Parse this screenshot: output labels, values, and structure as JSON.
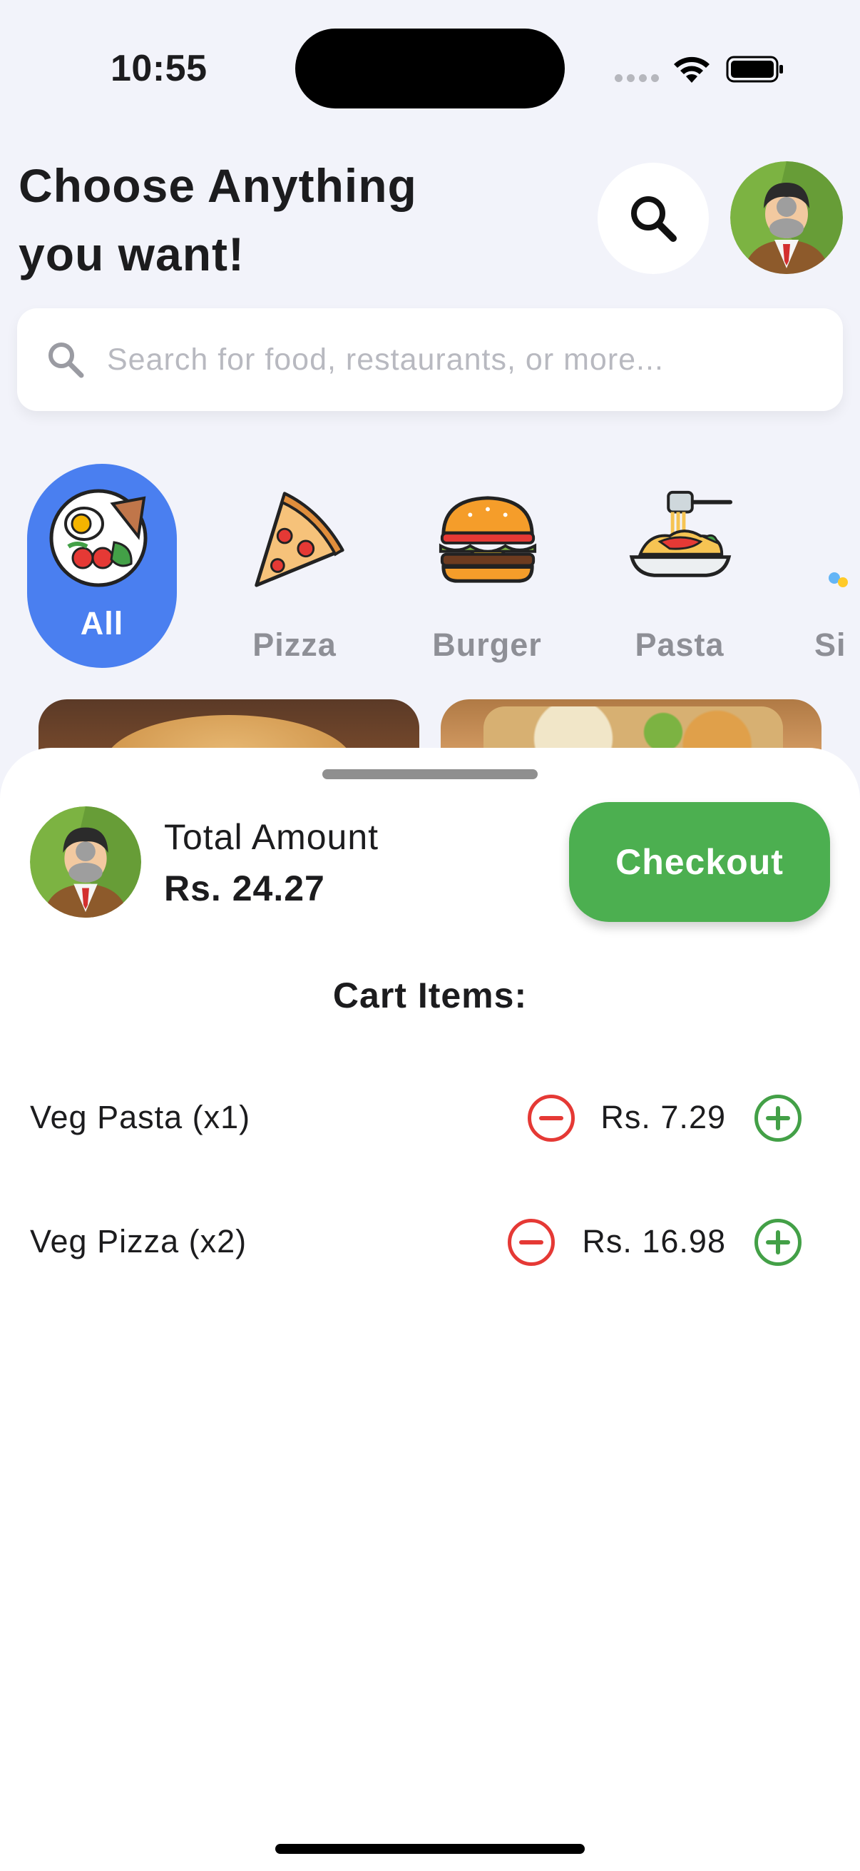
{
  "status_bar": {
    "time": "10:55"
  },
  "header": {
    "title_line1": "Choose Anything",
    "title_line2": "you want!"
  },
  "search": {
    "placeholder": "Search for food, restaurants, or more..."
  },
  "categories": [
    {
      "label": "All",
      "active": true
    },
    {
      "label": "Pizza",
      "active": false
    },
    {
      "label": "Burger",
      "active": false
    },
    {
      "label": "Pasta",
      "active": false
    },
    {
      "label": "Si",
      "active": false
    }
  ],
  "cart_sheet": {
    "total_label": "Total Amount",
    "total_amount": "Rs. 24.27",
    "checkout_label": "Checkout",
    "cart_title": "Cart Items:",
    "items": [
      {
        "name": "Veg Pasta (x1)",
        "price": "Rs. 7.29"
      },
      {
        "name": "Veg Pizza (x2)",
        "price": "Rs. 16.98"
      }
    ]
  },
  "colors": {
    "accent_blue": "#4a7ff0",
    "checkout_green": "#4caf50",
    "minus_red": "#e53935",
    "plus_green": "#43a047",
    "background": "#f2f3fa"
  }
}
